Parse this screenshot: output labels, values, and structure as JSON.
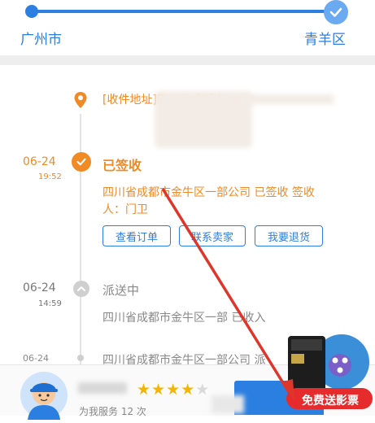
{
  "route": {
    "origin": "广州市",
    "destination": "青羊区"
  },
  "address": {
    "text": "[收件地址]四川省成都市"
  },
  "events": [
    {
      "date": "06-24",
      "time": "19:52",
      "status": "已签收",
      "detail_line1": "四川省成都市金牛区一部公司 已签收 签收",
      "detail_line2": "人：门卫"
    },
    {
      "date": "06-24",
      "time": "14:59",
      "status": "派送中",
      "detail_line1": "四川省成都市金牛区一部 已收入"
    },
    {
      "date": "06-24",
      "detail_line1": "四川省成都市金牛区一部公司 派"
    }
  ],
  "actions": {
    "view_order": "查看订单",
    "contact_seller": "联系卖家",
    "return_goods": "我要退货"
  },
  "courier": {
    "served_text": "为我服务 12 次",
    "rating_stars": 4
  },
  "promo": {
    "label": "免费送影票"
  },
  "colors": {
    "accent_blue": "#2b7fe0",
    "accent_orange": "#f08a24",
    "arrow_red": "#e0352b"
  }
}
